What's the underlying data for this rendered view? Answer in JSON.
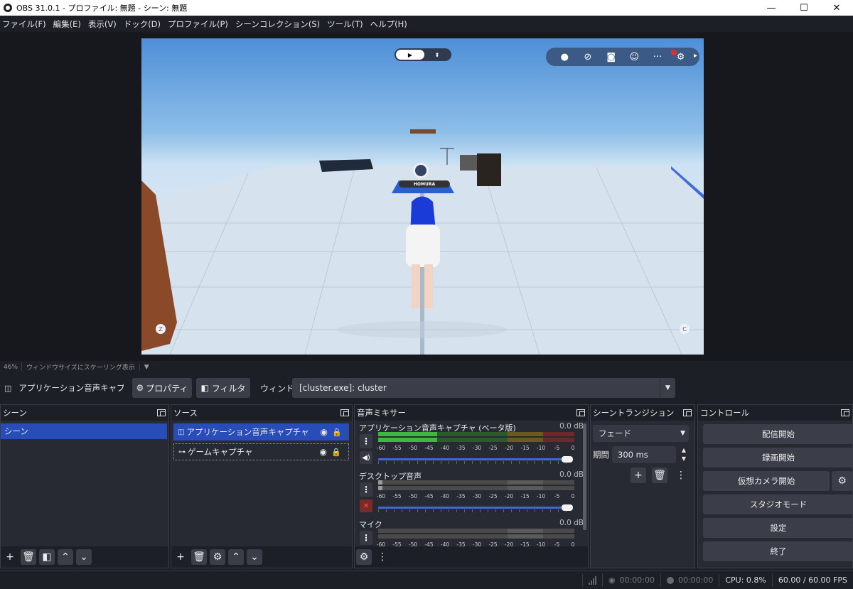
{
  "window": {
    "title": "OBS 31.0.1 - プロファイル: 無題 - シーン: 無題",
    "minimize": "—",
    "maximize": "☐",
    "close": "✕"
  },
  "menu": [
    "ファイル(F)",
    "編集(E)",
    "表示(V)",
    "ドック(D)",
    "プロファイル(P)",
    "シーンコレクション(S)",
    "ツール(T)",
    "ヘルプ(H)"
  ],
  "game": {
    "player_name": "HOMURA",
    "key_left": "Z",
    "key_right": "C"
  },
  "preview_status": {
    "zoom": "46%",
    "scaling": "ウィンドウサイズにスケーリング表示",
    "caret": "▼"
  },
  "source_bar": {
    "selected_source": "アプリケーション音声キャプチャ (ベータ版)",
    "properties": "プロパティ",
    "filters": "フィルタ",
    "window_label": "ウィンドウ",
    "window_value": "[cluster.exe]: cluster"
  },
  "docks": {
    "scenes": {
      "title": "シーン",
      "items": [
        "シーン"
      ]
    },
    "sources": {
      "title": "ソース",
      "items": [
        {
          "label": "アプリケーション音声キャプチャ (ベータ版)",
          "selected": true
        },
        {
          "label": "ゲームキャプチャ",
          "selected": false
        }
      ]
    },
    "mixer": {
      "title": "音声ミキサー",
      "ticks": [
        "-60",
        "-55",
        "-50",
        "-45",
        "-40",
        "-35",
        "-30",
        "-25",
        "-20",
        "-15",
        "-10",
        "-5",
        "0"
      ],
      "channels": [
        {
          "name": "アプリケーション音声キャプチャ (ベータ版)",
          "db": "0.0 dB",
          "muted": false,
          "level": 0.3
        },
        {
          "name": "デスクトップ音声",
          "db": "0.0 dB",
          "muted": true,
          "level": 0.02
        },
        {
          "name": "マイク",
          "db": "0.0 dB",
          "muted": false,
          "level": 0.0
        }
      ]
    },
    "transitions": {
      "title": "シーントランジション",
      "type": "フェード",
      "duration_label": "期間",
      "duration_value": "300 ms"
    },
    "controls": {
      "title": "コントロール",
      "start_streaming": "配信開始",
      "start_recording": "録画開始",
      "start_virtual_cam": "仮想カメラ開始",
      "studio_mode": "スタジオモード",
      "settings": "設定",
      "exit": "終了"
    }
  },
  "statusbar": {
    "stream_time": "00:00:00",
    "record_time": "00:00:00",
    "cpu": "CPU: 0.8%",
    "fps": "60.00 / 60.00 FPS"
  },
  "colors": {
    "accent": "#284cb8",
    "panel": "#272a33",
    "background": "#1d1f26",
    "meter_green": "#3fb83f",
    "meter_yellow": "#c9a520",
    "meter_red": "#c63a3a"
  }
}
